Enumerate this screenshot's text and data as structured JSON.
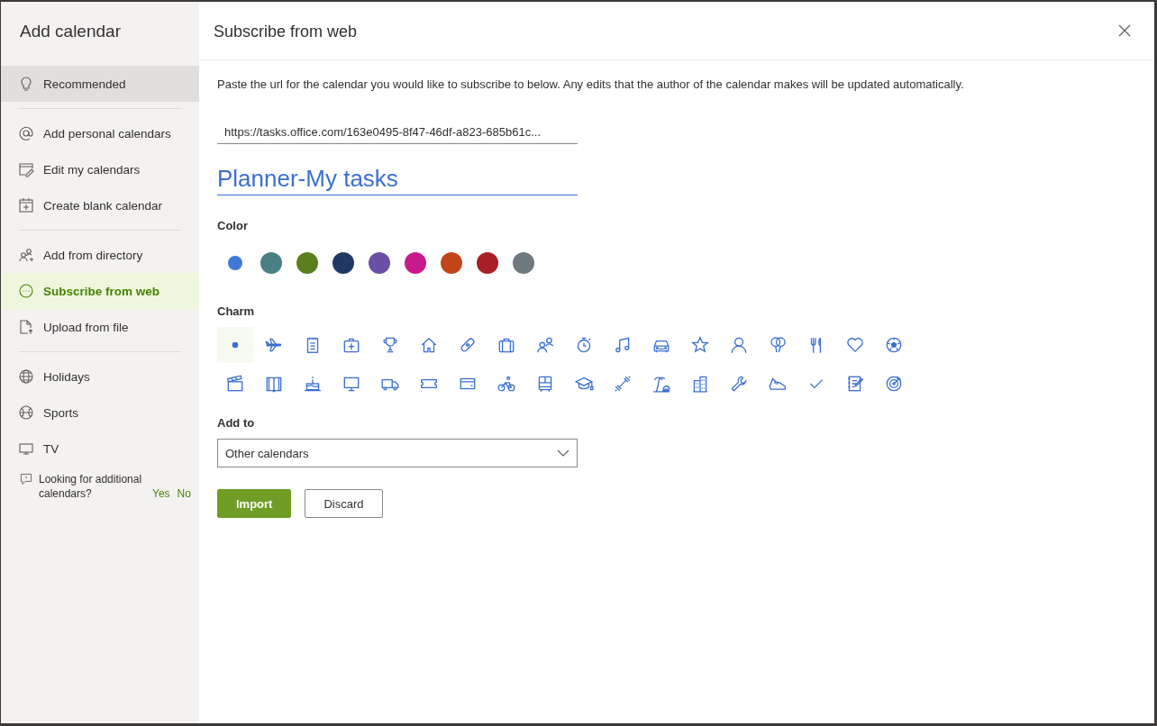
{
  "sidebar": {
    "title": "Add calendar",
    "sections": [
      {
        "items": [
          {
            "label": "Recommended",
            "selected": false,
            "hovered": true
          }
        ]
      },
      {
        "items": [
          {
            "label": "Add personal calendars",
            "selected": false,
            "hovered": false
          },
          {
            "label": "Edit my calendars",
            "selected": false,
            "hovered": false
          },
          {
            "label": "Create blank calendar",
            "selected": false,
            "hovered": false
          }
        ]
      },
      {
        "items": [
          {
            "label": "Add from directory",
            "selected": false,
            "hovered": false
          },
          {
            "label": "Subscribe from web",
            "selected": true,
            "hovered": false
          },
          {
            "label": "Upload from file",
            "selected": false,
            "hovered": false
          }
        ]
      },
      {
        "items": [
          {
            "label": "Holidays",
            "selected": false,
            "hovered": false
          },
          {
            "label": "Sports",
            "selected": false,
            "hovered": false
          },
          {
            "label": "TV",
            "selected": false,
            "hovered": false
          }
        ]
      }
    ],
    "feedback": {
      "text": "Looking for additional calendars?",
      "yes": "Yes",
      "no": "No"
    }
  },
  "dialog": {
    "title": "Subscribe from web",
    "description": "Paste the url for the calendar you would like to subscribe to below. Any edits that the author of the calendar makes will be updated automatically.",
    "url_field": {
      "value": "https://tasks.office.com/163e0495-8f47-46df-a823-685b61c..."
    },
    "name_field": {
      "value": "Planner-My tasks"
    },
    "color_label": "Color",
    "colors": [
      {
        "color": "#3f78d6",
        "selected": true
      },
      {
        "color": "#4a8085",
        "selected": false
      },
      {
        "color": "#5b7f1f",
        "selected": false
      },
      {
        "color": "#1f3864",
        "selected": false
      },
      {
        "color": "#6b4fa7",
        "selected": false
      },
      {
        "color": "#c71a8d",
        "selected": false
      },
      {
        "color": "#c2451a",
        "selected": false
      },
      {
        "color": "#a81f26",
        "selected": false
      },
      {
        "color": "#6f7a7e",
        "selected": false
      }
    ],
    "charm_label": "Charm",
    "charms": [
      {
        "kind": "dot",
        "selected": true
      },
      {
        "kind": "airplane",
        "selected": false
      },
      {
        "kind": "notepad",
        "selected": false
      },
      {
        "kind": "medkit",
        "selected": false
      },
      {
        "kind": "trophy",
        "selected": false
      },
      {
        "kind": "home",
        "selected": false
      },
      {
        "kind": "bandage",
        "selected": false
      },
      {
        "kind": "briefcase",
        "selected": false
      },
      {
        "kind": "people",
        "selected": false
      },
      {
        "kind": "stopwatch",
        "selected": false
      },
      {
        "kind": "music",
        "selected": false
      },
      {
        "kind": "car",
        "selected": false
      },
      {
        "kind": "star",
        "selected": false
      },
      {
        "kind": "person",
        "selected": false
      },
      {
        "kind": "balloons",
        "selected": false
      },
      {
        "kind": "cutlery",
        "selected": false
      },
      {
        "kind": "heart",
        "selected": false
      },
      {
        "kind": "ball",
        "selected": false
      },
      {
        "kind": "clapperboard",
        "selected": false
      },
      {
        "kind": "book",
        "selected": false
      },
      {
        "kind": "cake",
        "selected": false
      },
      {
        "kind": "monitor",
        "selected": false
      },
      {
        "kind": "truck",
        "selected": false
      },
      {
        "kind": "ticket",
        "selected": false
      },
      {
        "kind": "card",
        "selected": false
      },
      {
        "kind": "bicycle",
        "selected": false
      },
      {
        "kind": "bus",
        "selected": false
      },
      {
        "kind": "gradcap",
        "selected": false
      },
      {
        "kind": "dumbbell",
        "selected": false
      },
      {
        "kind": "beach",
        "selected": false
      },
      {
        "kind": "building",
        "selected": false
      },
      {
        "kind": "wrench",
        "selected": false
      },
      {
        "kind": "sneaker",
        "selected": false
      },
      {
        "kind": "check",
        "selected": false
      },
      {
        "kind": "notebook",
        "selected": false
      },
      {
        "kind": "target",
        "selected": false
      }
    ],
    "add_to_label": "Add to",
    "add_to": {
      "value": "Other calendars"
    },
    "buttons": [
      {
        "label": "Import",
        "kind": "primary"
      },
      {
        "label": "Discard",
        "kind": "secondary"
      }
    ]
  }
}
